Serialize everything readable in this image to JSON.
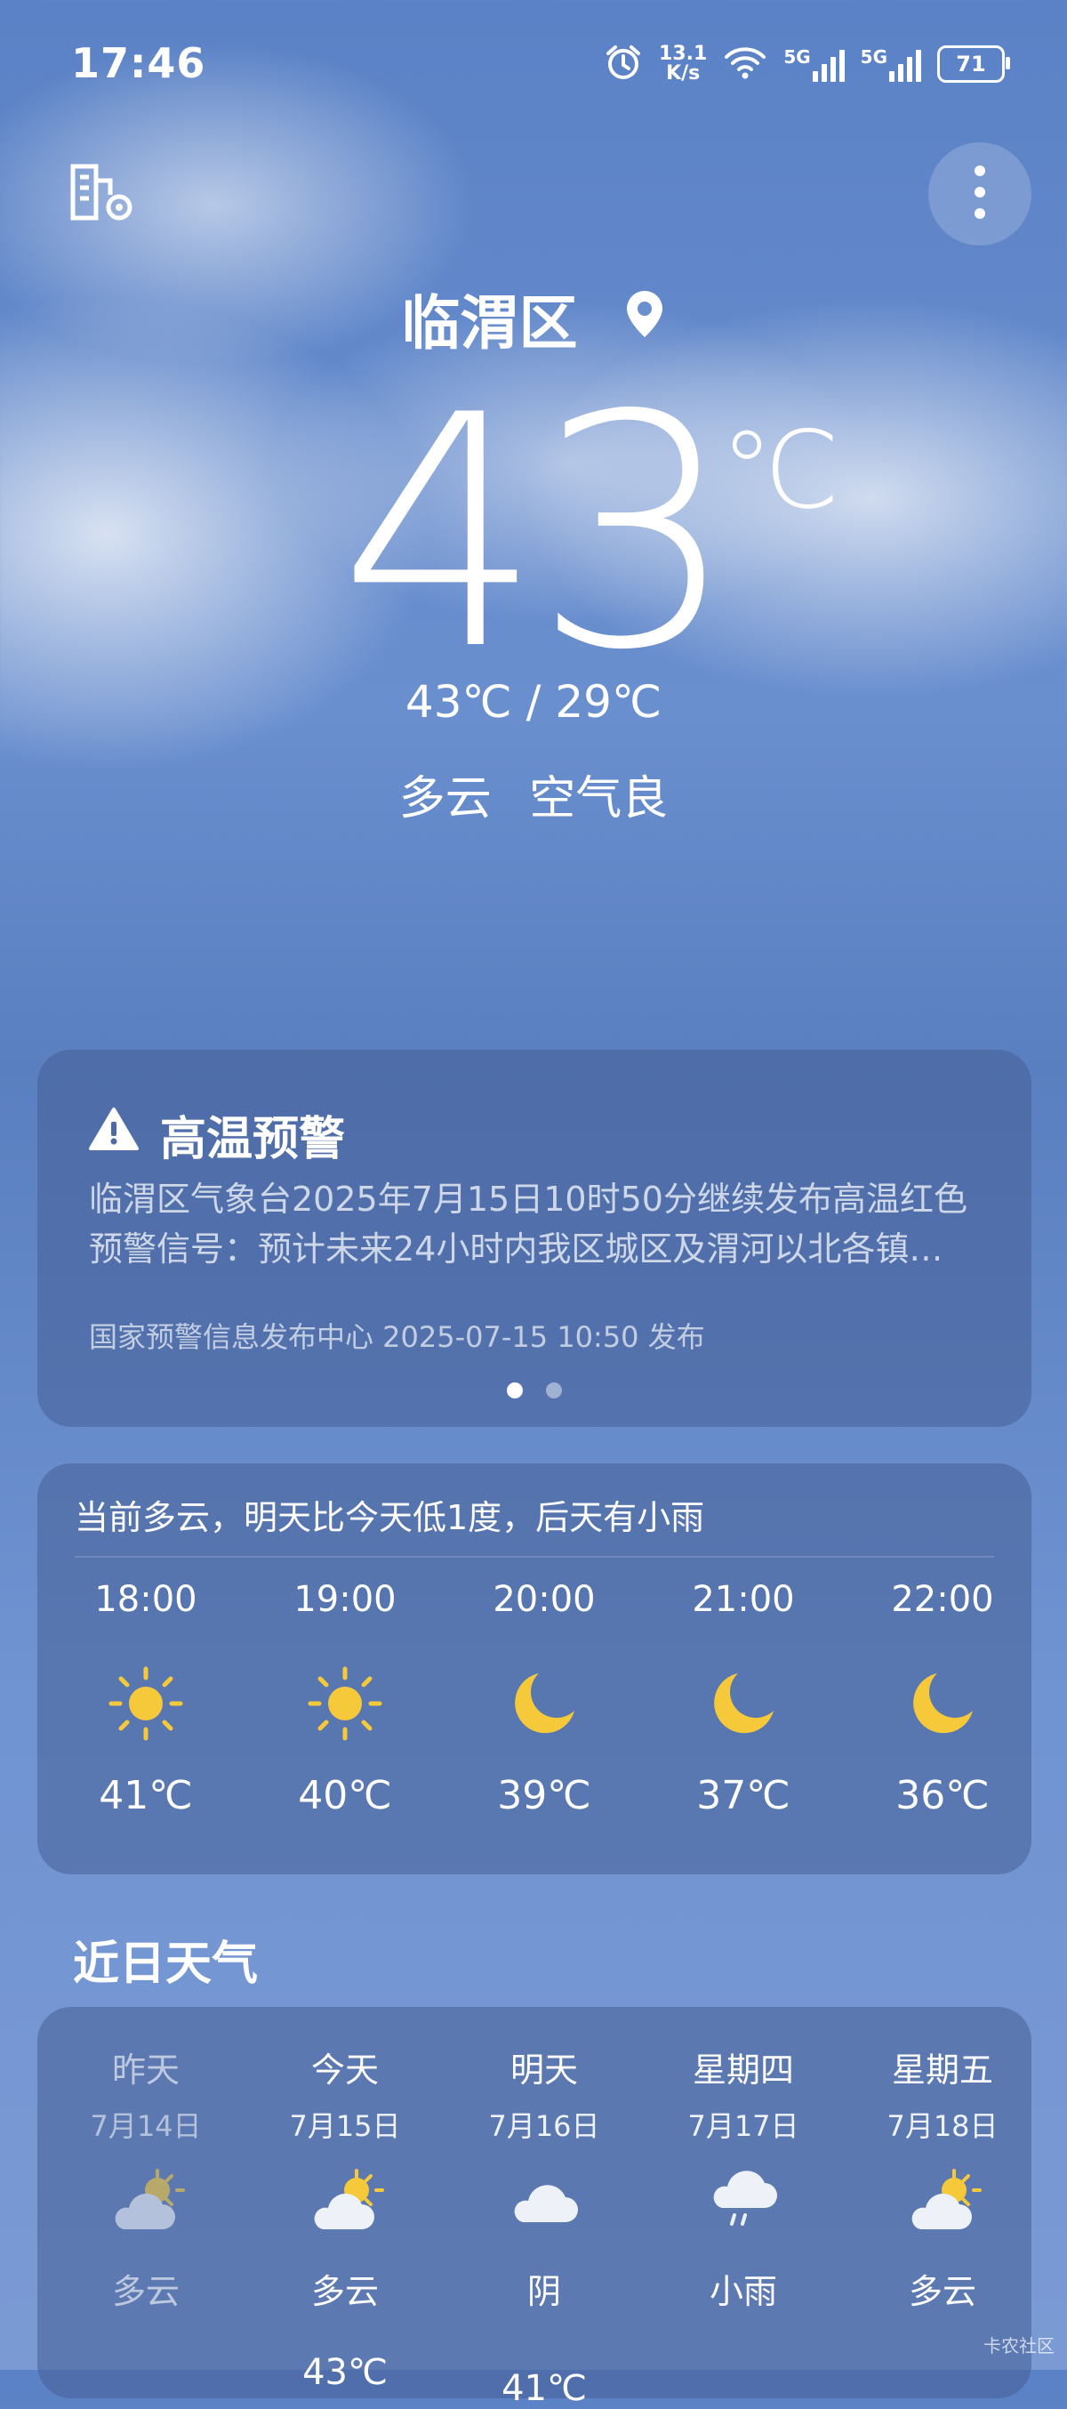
{
  "status_bar": {
    "time": "17:46",
    "net_speed_value": "13.1",
    "net_speed_unit": "K/s",
    "sim1_label": "5G",
    "sim2_label": "5G",
    "battery": "71"
  },
  "header": {
    "city": "临渭区",
    "current_temp": "43",
    "temp_unit": "℃",
    "range": "43℃ / 29℃",
    "condition": "多云",
    "air_quality": "空气良"
  },
  "alert": {
    "title": "高温预警",
    "text": "临渭区气象台2025年7月15日10时50分继续发布高温红色预警信号：预计未来24小时内我区城区及渭河以北各镇…",
    "source": "国家预警信息发布中心 2025-07-15 10:50 发布",
    "page_count": 2,
    "active_page": 1
  },
  "hourly": {
    "summary": "当前多云，明天比今天低1度，后天有小雨",
    "items": [
      {
        "time": "18:00",
        "icon": "sun-icon",
        "temp": "41℃"
      },
      {
        "time": "19:00",
        "icon": "sun-icon",
        "temp": "40℃"
      },
      {
        "time": "20:00",
        "icon": "moon-icon",
        "temp": "39℃"
      },
      {
        "time": "21:00",
        "icon": "moon-icon",
        "temp": "37℃"
      },
      {
        "time": "22:00",
        "icon": "moon-icon",
        "temp": "36℃"
      }
    ]
  },
  "daily": {
    "title": "近日天气",
    "items": [
      {
        "name": "昨天",
        "date": "7月14日",
        "icon": "partly-cloudy-icon",
        "cond": "多云",
        "high": ""
      },
      {
        "name": "今天",
        "date": "7月15日",
        "icon": "partly-cloudy-icon",
        "cond": "多云",
        "high": "43℃"
      },
      {
        "name": "明天",
        "date": "7月16日",
        "icon": "cloud-icon",
        "cond": "阴",
        "high": "41℃"
      },
      {
        "name": "星期四",
        "date": "7月17日",
        "icon": "rain-icon",
        "cond": "小雨",
        "high": ""
      },
      {
        "name": "星期五",
        "date": "7月18日",
        "icon": "partly-cloudy-icon",
        "cond": "多云",
        "high": ""
      }
    ]
  },
  "watermark": "卡农社区",
  "colors": {
    "sky_top": "#5b82c6",
    "card_bg": "#465f96",
    "sun_yellow": "#f5c93a"
  }
}
